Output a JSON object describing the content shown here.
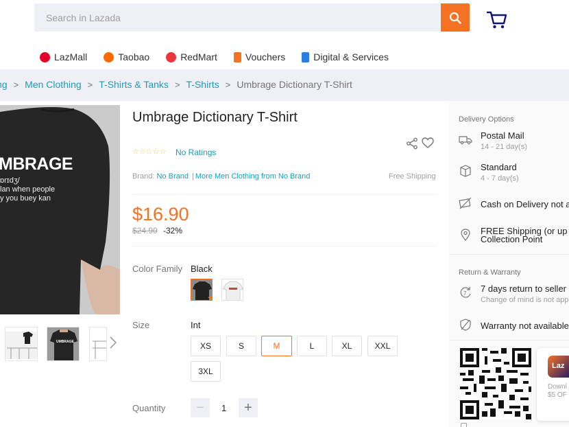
{
  "search": {
    "placeholder": "Search in Lazada"
  },
  "nav": [
    {
      "label": "LazMall",
      "color": "#e4002b"
    },
    {
      "label": "Taobao",
      "color": "#ff6a00"
    },
    {
      "label": "RedMart",
      "color": "#e8383d"
    },
    {
      "label": "Vouchers",
      "color": "#f57224"
    },
    {
      "label": "Digital & Services",
      "color": "#2a7de1"
    }
  ],
  "breadcrumb": {
    "items": [
      "ng",
      "Men Clothing",
      "T-Shirts & Tanks",
      "T-Shirts"
    ],
    "current": "Umbrage Dictionary T-Shirt"
  },
  "gallery": {
    "main_word": "MBRAGE",
    "main_phonetic": "ɒrɪdʒ/",
    "main_line1": "lan when people",
    "main_line2": "y you buey kan",
    "thumb_word": "UMBRAGE"
  },
  "product": {
    "title": "Umbrage Dictionary T-Shirt",
    "stars": "☆☆☆☆☆",
    "ratings": "No Ratings",
    "brand_label": "Brand:",
    "brand": "No Brand",
    "more_link": "More Men Clothing from No Brand",
    "free_shipping": "Free Shipping",
    "price": "$16.90",
    "original_price": "$24.90",
    "discount": "-32%",
    "color_label": "Color Family",
    "color_value": "Black",
    "size_label": "Size",
    "size_value": "Int",
    "sizes": [
      "XS",
      "S",
      "M",
      "L",
      "XL",
      "XXL",
      "3XL"
    ],
    "selected_size": "M",
    "quantity_label": "Quantity",
    "quantity": "1",
    "minus": "−",
    "plus": "+"
  },
  "delivery": {
    "heading": "Delivery Options",
    "options": [
      {
        "title": "Postal Mail",
        "sub": "14 - 21 day(s)"
      },
      {
        "title": "Standard",
        "sub": "4 - 7 day(s)"
      },
      {
        "title": "Cash on Delivery not a",
        "sub": ""
      },
      {
        "title": "FREE Shipping (or up",
        "sub": "Collection Point"
      }
    ]
  },
  "warranty": {
    "heading": "Return & Warranty",
    "return_title": "7 days return to seller",
    "return_sub": "Change of mind is not app",
    "warranty_title": "Warranty not available"
  },
  "app": {
    "logo": "Laz",
    "line1": "Downl",
    "line2": "$5 OF"
  },
  "colors": {
    "accent": "#f57224",
    "link": "#1a9cb7",
    "bg_gray": "#eff0f5"
  }
}
